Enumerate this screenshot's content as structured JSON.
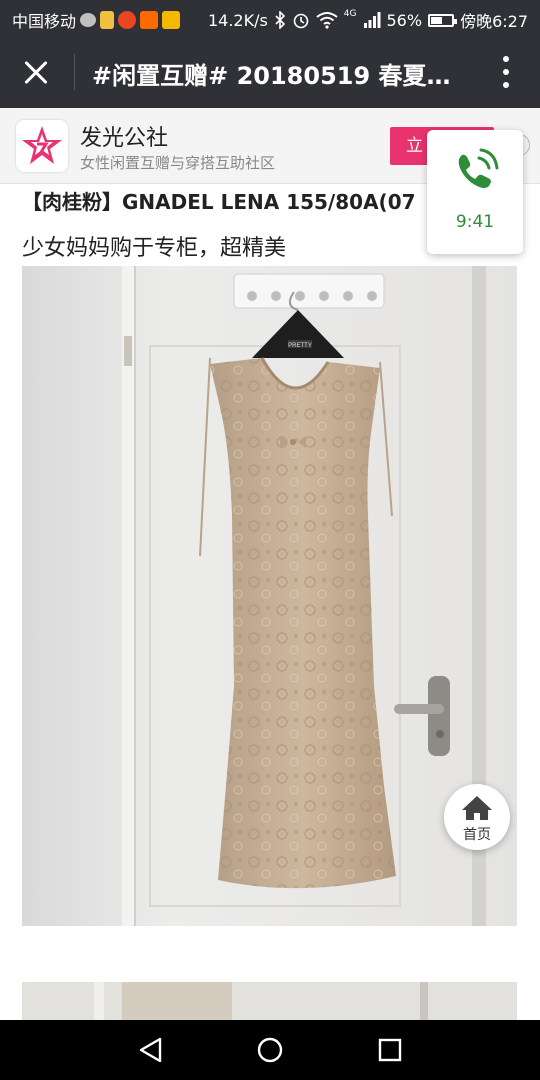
{
  "status_bar": {
    "carrier": "中国移动",
    "speed": "14.2K/s",
    "network": "4G",
    "battery": "56%",
    "battery_level": 0.56,
    "time": "傍晚6:27"
  },
  "nav": {
    "title": "#闲置互赠# 20180519 春夏…"
  },
  "banner": {
    "brand_name": "发光公社",
    "brand_sub": "女性闲置互赠与穿搭互助社区",
    "open_label": "立",
    "close_glyph": "×"
  },
  "call_card": {
    "time": "9:41",
    "color": "#2f8c3a"
  },
  "article": {
    "title": "【肉桂粉】GNADEL LENA 155/80A(07",
    "description": "少女妈妈购于专柜，超精美",
    "hanger_label": "PRETTY"
  },
  "home_float": {
    "label": "首页"
  },
  "colors": {
    "top_bar": "#2f3136",
    "accent": "#e8336e"
  }
}
